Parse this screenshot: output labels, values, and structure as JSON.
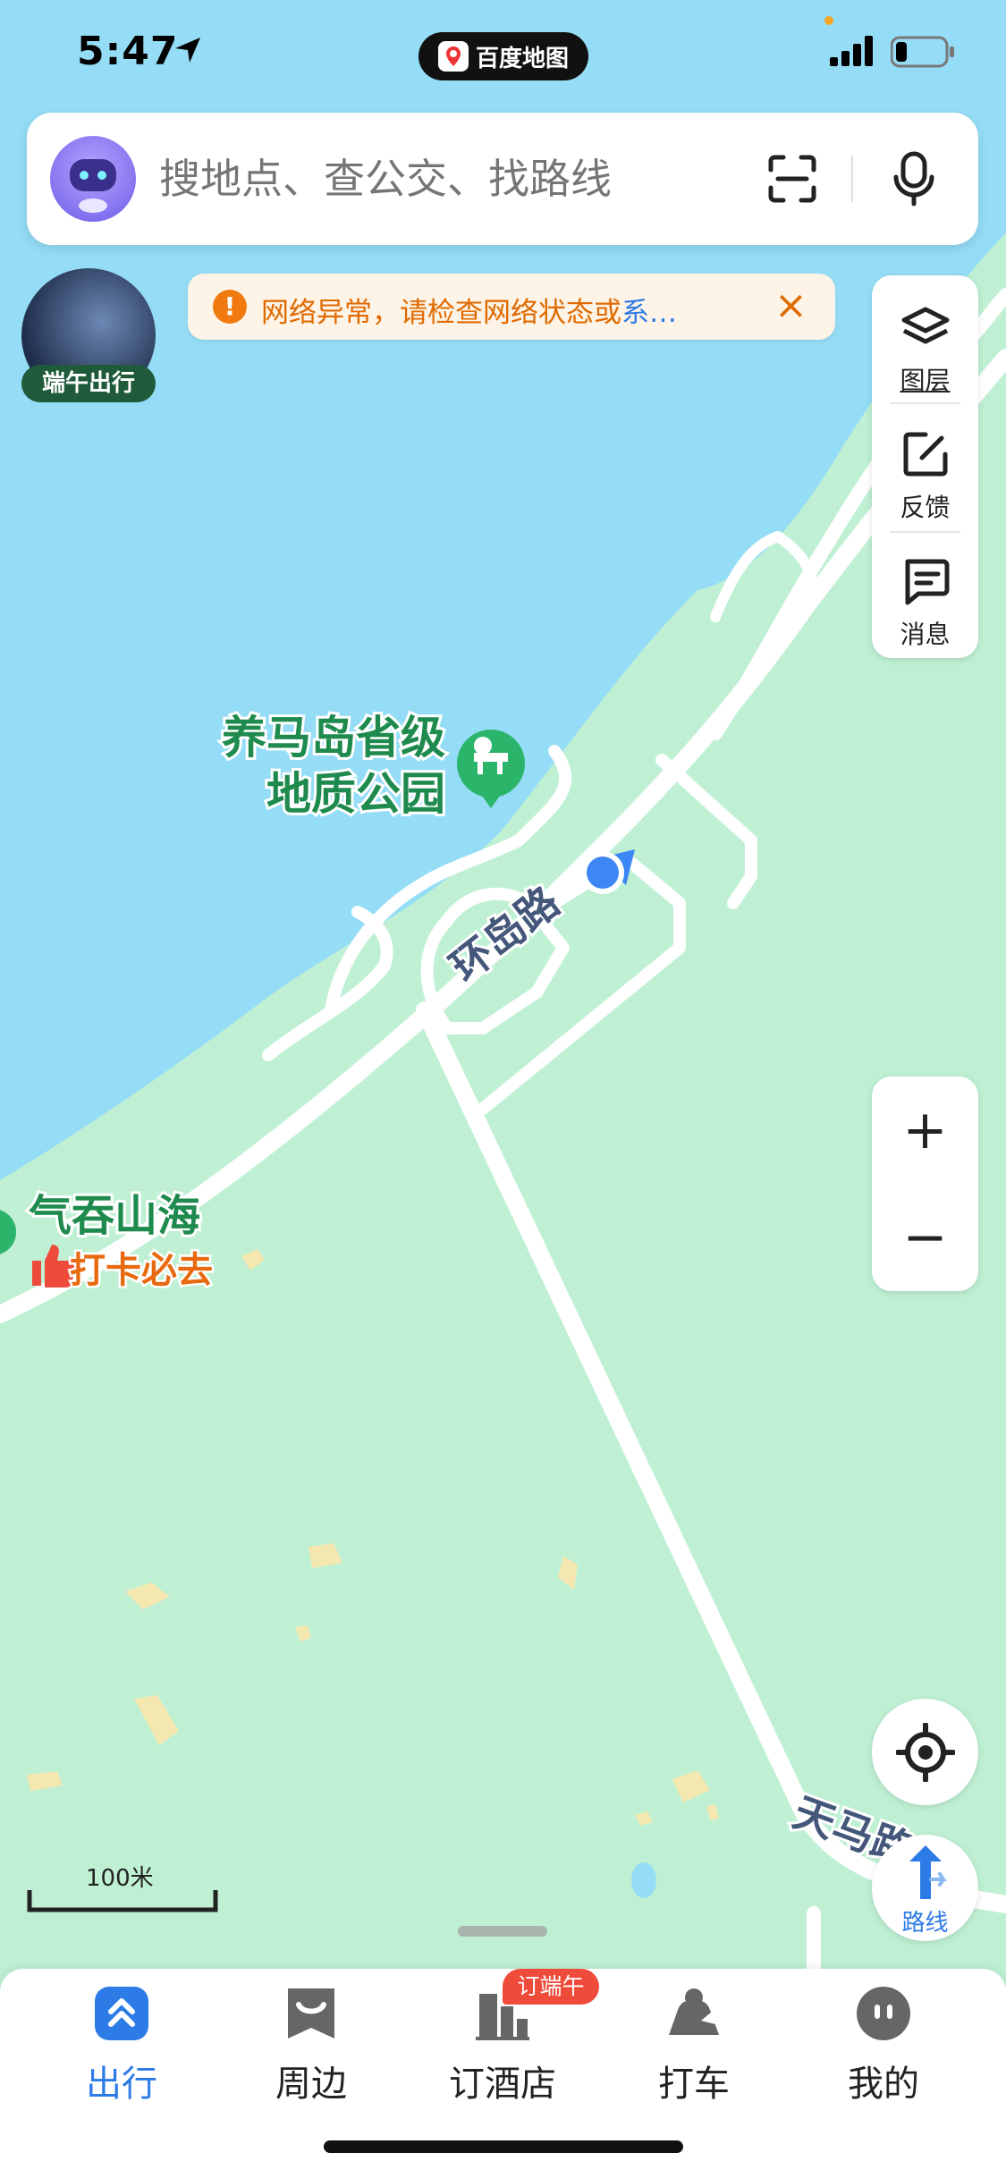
{
  "status_bar": {
    "time": "5:47",
    "app_pill": "百度地图"
  },
  "search": {
    "placeholder": "搜地点、查公交、找路线"
  },
  "festival": {
    "label": "端午出行"
  },
  "alert": {
    "message": "网络异常，请检查网络状态或",
    "link": "系…"
  },
  "right_panel": {
    "items": [
      {
        "label": "图层",
        "icon": "layers-icon"
      },
      {
        "label": "反馈",
        "icon": "edit-icon"
      },
      {
        "label": "消息",
        "icon": "message-icon"
      }
    ]
  },
  "map": {
    "poi_park_line1": "养马岛省级",
    "poi_park_line2": "地质公园",
    "poi_scenic_name": "气吞山海",
    "poi_scenic_tag": "打卡必去",
    "road_huandao": "环岛路",
    "road_tianma": "天马路",
    "scale_label": "100米",
    "colors": {
      "water": "#95ddf6",
      "land": "#bff0d4",
      "road": "#ffffff",
      "poi_green": "#1e8a4e",
      "location_blue": "#3d86f5"
    }
  },
  "controls": {
    "zoom_in": "+",
    "zoom_out": "−",
    "route_label": "路线"
  },
  "bottom_nav": {
    "tabs": [
      {
        "label": "出行",
        "icon": "travel-icon",
        "active": true
      },
      {
        "label": "周边",
        "icon": "nearby-icon",
        "active": false
      },
      {
        "label": "订酒店",
        "icon": "hotel-icon",
        "active": false
      },
      {
        "label": "打车",
        "icon": "taxi-icon",
        "active": false
      },
      {
        "label": "我的",
        "icon": "profile-icon",
        "active": false
      }
    ],
    "hotel_badge": "订端午"
  }
}
